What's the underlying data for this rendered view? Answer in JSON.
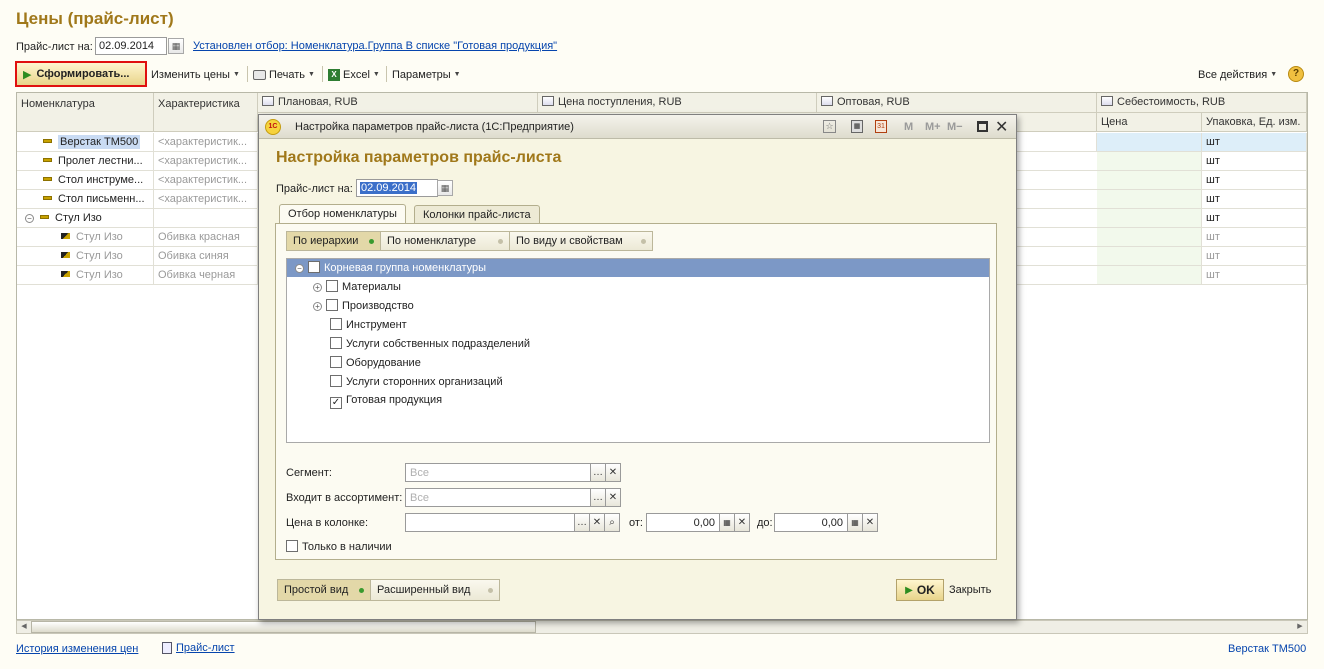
{
  "page": {
    "title": "Цены (прайс-лист)",
    "pricelist_label": "Прайс-лист на:",
    "pricelist_date": "02.09.2014",
    "filter_link": "Установлен отбор: Номенклатура.Группа В списке \"Готовая продукция\""
  },
  "toolbar": {
    "form_button": "Сформировать...",
    "change_prices": "Изменить цены",
    "print": "Печать",
    "excel": "Excel",
    "params": "Параметры",
    "all_actions": "Все действия",
    "help": "?"
  },
  "grid": {
    "headers": {
      "nomenclature": "Номенклатура",
      "characteristic": "Характеристика",
      "planned": "Плановая, RUB",
      "receipt": "Цена поступления, RUB",
      "wholesale": "Оптовая, RUB",
      "cost": "Себестоимость, RUB",
      "price": "Цена",
      "package": "Упаковка, Ед. изм."
    },
    "rows": [
      {
        "name": "Верстак ТМ500",
        "char": "<характеристик...",
        "unit": "шт"
      },
      {
        "name": "Пролет лестни...",
        "char": "<характеристик...",
        "unit": "шт"
      },
      {
        "name": "Стол инструме...",
        "char": "<характеристик...",
        "unit": "шт"
      },
      {
        "name": "Стол письменн...",
        "char": "<характеристик...",
        "unit": "шт"
      },
      {
        "name": "Стул Изо",
        "char": "",
        "unit": "шт"
      },
      {
        "name": "Стул Изо",
        "char": "Обивка красная",
        "unit": "шт"
      },
      {
        "name": "Стул Изо",
        "char": "Обивка синяя",
        "unit": "шт"
      },
      {
        "name": "Стул Изо",
        "char": "Обивка  черная",
        "unit": "шт"
      }
    ]
  },
  "footer": {
    "history_link": "История изменения цен",
    "pricelist_link": "Прайс-лист",
    "current_item": "Верстак ТМ500"
  },
  "dialog": {
    "window_title": "Настройка параметров прайс-листа  (1С:Предприятие)",
    "heading": "Настройка параметров прайс-листа",
    "date_label": "Прайс-лист на:",
    "date_value": "02.09.2014",
    "tabs": [
      "Отбор номенклатуры",
      "Колонки прайс-листа"
    ],
    "modes": [
      "По иерархии",
      "По номенклатуре",
      "По виду и свойствам"
    ],
    "tree": {
      "root": "Корневая группа номенклатуры",
      "items": [
        "Материалы",
        "Производство",
        "Инструмент",
        "Услуги собственных подразделений",
        "Оборудование",
        "Услуги сторонних организаций",
        "Готовая продукция"
      ]
    },
    "segment_label": "Сегмент:",
    "segment_placeholder": "Все",
    "assortment_label": "Входит в ассортимент:",
    "assortment_placeholder": "Все",
    "price_col_label": "Цена в колонке:",
    "from_label": "от:",
    "from_value": "0,00",
    "to_label": "до:",
    "to_value": "0,00",
    "only_available": "Только в наличии",
    "view_simple": "Простой вид",
    "view_extended": "Расширенный вид",
    "ok": "OK",
    "close": "Закрыть",
    "title_btns": {
      "m": "M",
      "mplus": "M+",
      "mminus": "M−"
    }
  }
}
